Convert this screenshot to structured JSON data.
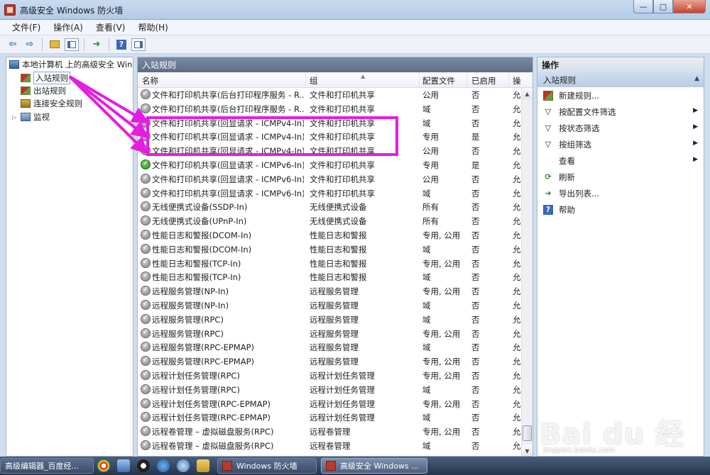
{
  "window": {
    "title": "高级安全 Windows 防火墙",
    "minimize": "—",
    "maximize": "□",
    "close": "✕"
  },
  "menu": [
    "文件(F)",
    "操作(A)",
    "查看(V)",
    "帮助(H)"
  ],
  "toolbar": {
    "back": "⇦",
    "forward": "⇨",
    "help": "?"
  },
  "tree": {
    "root": "本地计算机 上的高级安全 Windows 防火墙",
    "items": [
      "入站规则",
      "出站规则",
      "连接安全规则",
      "监视"
    ]
  },
  "center": {
    "header": "入站规则",
    "columns": [
      "名称",
      "组",
      "配置文件",
      "已启用",
      "操"
    ],
    "rows": [
      {
        "name": "文件和打印机共享(后台打印程序服务 - R...",
        "group": "文件和打印机共享",
        "profile": "公用",
        "enabled": "否",
        "action": "允",
        "on": false
      },
      {
        "name": "文件和打印机共享(后台打印程序服务 - R...",
        "group": "文件和打印机共享",
        "profile": "域",
        "enabled": "否",
        "action": "允",
        "on": false
      },
      {
        "name": "文件和打印机共享(回显请求 - ICMPv4-In)",
        "group": "文件和打印机共享",
        "profile": "域",
        "enabled": "否",
        "action": "允",
        "on": false
      },
      {
        "name": "文件和打印机共享(回显请求 - ICMPv4-In)",
        "group": "文件和打印机共享",
        "profile": "专用",
        "enabled": "是",
        "action": "允",
        "on": false
      },
      {
        "name": "文件和打印机共享(回显请求 - ICMPv4-In)",
        "group": "文件和打印机共享",
        "profile": "公用",
        "enabled": "否",
        "action": "允",
        "on": false
      },
      {
        "name": "文件和打印机共享(回显请求 - ICMPv6-In)",
        "group": "文件和打印机共享",
        "profile": "专用",
        "enabled": "是",
        "action": "允",
        "on": true
      },
      {
        "name": "文件和打印机共享(回显请求 - ICMPv6-In)",
        "group": "文件和打印机共享",
        "profile": "公用",
        "enabled": "否",
        "action": "允",
        "on": false
      },
      {
        "name": "文件和打印机共享(回显请求 - ICMPv6-In)",
        "group": "文件和打印机共享",
        "profile": "域",
        "enabled": "否",
        "action": "允",
        "on": false
      },
      {
        "name": "无线便携式设备(SSDP-In)",
        "group": "无线便携式设备",
        "profile": "所有",
        "enabled": "否",
        "action": "允",
        "on": false
      },
      {
        "name": "无线便携式设备(UPnP-In)",
        "group": "无线便携式设备",
        "profile": "所有",
        "enabled": "否",
        "action": "允",
        "on": false
      },
      {
        "name": "性能日志和警报(DCOM-In)",
        "group": "性能日志和警报",
        "profile": "专用, 公用",
        "enabled": "否",
        "action": "允",
        "on": false
      },
      {
        "name": "性能日志和警报(DCOM-In)",
        "group": "性能日志和警报",
        "profile": "域",
        "enabled": "否",
        "action": "允",
        "on": false
      },
      {
        "name": "性能日志和警报(TCP-In)",
        "group": "性能日志和警报",
        "profile": "专用, 公用",
        "enabled": "否",
        "action": "允",
        "on": false
      },
      {
        "name": "性能日志和警报(TCP-In)",
        "group": "性能日志和警报",
        "profile": "域",
        "enabled": "否",
        "action": "允",
        "on": false
      },
      {
        "name": "远程服务管理(NP-In)",
        "group": "远程服务管理",
        "profile": "专用, 公用",
        "enabled": "否",
        "action": "允",
        "on": false
      },
      {
        "name": "远程服务管理(NP-In)",
        "group": "远程服务管理",
        "profile": "域",
        "enabled": "否",
        "action": "允",
        "on": false
      },
      {
        "name": "远程服务管理(RPC)",
        "group": "远程服务管理",
        "profile": "域",
        "enabled": "否",
        "action": "允",
        "on": false
      },
      {
        "name": "远程服务管理(RPC)",
        "group": "远程服务管理",
        "profile": "专用, 公用",
        "enabled": "否",
        "action": "允",
        "on": false
      },
      {
        "name": "远程服务管理(RPC-EPMAP)",
        "group": "远程服务管理",
        "profile": "域",
        "enabled": "否",
        "action": "允",
        "on": false
      },
      {
        "name": "远程服务管理(RPC-EPMAP)",
        "group": "远程服务管理",
        "profile": "专用, 公用",
        "enabled": "否",
        "action": "允",
        "on": false
      },
      {
        "name": "远程计划任务管理(RPC)",
        "group": "远程计划任务管理",
        "profile": "专用, 公用",
        "enabled": "否",
        "action": "允",
        "on": false
      },
      {
        "name": "远程计划任务管理(RPC)",
        "group": "远程计划任务管理",
        "profile": "域",
        "enabled": "否",
        "action": "允",
        "on": false
      },
      {
        "name": "远程计划任务管理(RPC-EPMAP)",
        "group": "远程计划任务管理",
        "profile": "专用, 公用",
        "enabled": "否",
        "action": "允",
        "on": false
      },
      {
        "name": "远程计划任务管理(RPC-EPMAP)",
        "group": "远程计划任务管理",
        "profile": "域",
        "enabled": "否",
        "action": "允",
        "on": false
      },
      {
        "name": "远程卷管理 – 虚拟磁盘服务(RPC)",
        "group": "远程卷管理",
        "profile": "专用, 公用",
        "enabled": "否",
        "action": "允",
        "on": false
      },
      {
        "name": "远程卷管理 – 虚拟磁盘服务(RPC)",
        "group": "远程卷管理",
        "profile": "域",
        "enabled": "否",
        "action": "允",
        "on": false
      }
    ]
  },
  "actions": {
    "header": "操作",
    "section": "入站规则",
    "items": [
      {
        "label": "新建规则...",
        "icon": "new-rule-icon",
        "submenu": false
      },
      {
        "label": "按配置文件筛选",
        "icon": "filter-icon",
        "submenu": true
      },
      {
        "label": "按状态筛选",
        "icon": "filter-icon",
        "submenu": true
      },
      {
        "label": "按组筛选",
        "icon": "filter-icon",
        "submenu": true
      },
      {
        "label": "查看",
        "icon": "",
        "submenu": true
      },
      {
        "label": "刷新",
        "icon": "refresh-icon",
        "submenu": false
      },
      {
        "label": "导出列表...",
        "icon": "export-icon",
        "submenu": false
      },
      {
        "label": "帮助",
        "icon": "help-icon",
        "submenu": false
      }
    ]
  },
  "taskbar": {
    "first": "高级编辑器_百度经...",
    "fw": "Windows 防火墙",
    "adv": "高级安全 Windows ..."
  },
  "watermark": {
    "brand": "Bai du 经验",
    "url": "jingyan.baidu.com"
  },
  "colors": {
    "highlight": "#e51de0",
    "enabled_green": "#2c8b1b"
  }
}
